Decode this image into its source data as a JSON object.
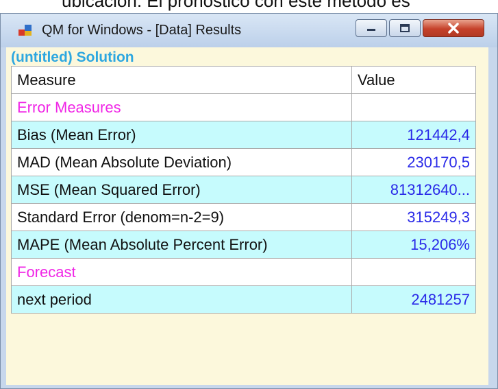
{
  "document": {
    "partial_text": "ubicación. El pronóstico con este método es"
  },
  "window": {
    "title": "QM for Windows - [Data] Results",
    "icon": "qm-app-icon",
    "controls": {
      "minimize": "minimize-icon",
      "maximize": "maximize-icon",
      "close": "close-icon"
    }
  },
  "solution": {
    "title": "(untitled) Solution",
    "headers": {
      "measure": "Measure",
      "value": "Value"
    },
    "rows": [
      {
        "measure": "Error Measures",
        "value": "",
        "kind": "section"
      },
      {
        "measure": "Bias (Mean Error)",
        "value": "121442,4",
        "kind": "data"
      },
      {
        "measure": "MAD (Mean Absolute Deviation)",
        "value": "230170,5",
        "kind": "data"
      },
      {
        "measure": "MSE (Mean Squared Error)",
        "value": "81312640...",
        "kind": "data"
      },
      {
        "measure": "Standard Error (denom=n-2=9)",
        "value": "315249,3",
        "kind": "data"
      },
      {
        "measure": "MAPE (Mean Absolute Percent Error)",
        "value": "15,206%",
        "kind": "data"
      },
      {
        "measure": "Forecast",
        "value": "",
        "kind": "section"
      },
      {
        "measure": "next period",
        "value": "2481257",
        "kind": "data"
      }
    ]
  },
  "colors": {
    "section_label": "#f026e6",
    "value_text": "#2a2ae8",
    "row_highlight": "#c6fbfd",
    "solution_title": "#2da7e0",
    "panel_background": "#fcf8dc"
  }
}
